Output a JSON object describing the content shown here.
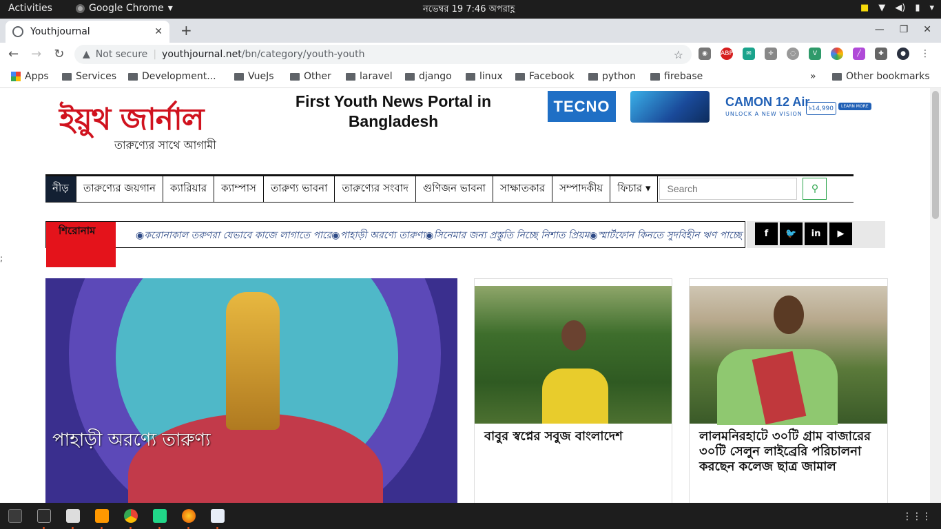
{
  "system": {
    "activities": "Activities",
    "app_name": "Google Chrome",
    "clock": "নভেম্বর 19   7:46 অপরাহ্ণ"
  },
  "browser": {
    "tab_title": "Youthjournal",
    "security": "Not secure",
    "url_host": "youthjournal.net",
    "url_path": "/bn/category/youth-youth",
    "bookmarks": [
      {
        "label": "Apps"
      },
      {
        "label": "Services"
      },
      {
        "label": "Development..."
      },
      {
        "label": "VueJs"
      },
      {
        "label": "Other"
      },
      {
        "label": "laravel"
      },
      {
        "label": "django"
      },
      {
        "label": "linux"
      },
      {
        "label": "Facebook"
      },
      {
        "label": "python"
      },
      {
        "label": "firebase"
      }
    ],
    "more_bookmarks": "»",
    "other_bookmarks": "Other bookmarks"
  },
  "site": {
    "logo_main": "ইয়ুথ জার্নাল",
    "logo_sub": "তারুণ্যের সাথে আগামী",
    "tagline": "First Youth News Portal in Bangladesh",
    "ad": {
      "brand": "TECNO",
      "model": "CAMON 12 Air",
      "vision": "UNLOCK A NEW VISION",
      "price": "৳14,990",
      "cta": "LEARN MORE"
    },
    "menu": [
      "নীড়",
      "তারুণ্যের জয়গান",
      "ক্যারিয়ার",
      "ক্যাম্পাস",
      "তারুণ্য ভাবনা",
      "তারুণ্যের সংবাদ",
      "গুণিজন ভাবনা",
      "সাক্ষাতকার",
      "সম্পাদকীয়",
      "ফিচার ▾"
    ],
    "search_placeholder": "Search",
    "ticker_head": "শিরোনাম",
    "ticker_text": "◉করোনাকাল তরুণরা যেভাবে কাজে লাগাতে পারে◉পাহাড়ী অরণ্যে তারুণ্য◉সিনেমার জন্য প্রস্তুতি নিচ্ছে নিশাত প্রিয়ম◉স্মার্টফোন কিনতে সুদবিহীন ঋণ পাচ্ছে",
    "social": [
      "f",
      "t",
      "in",
      "yt"
    ],
    "stray": ";",
    "featured_title": "পাহাড়ী অরণ্যে তারুণ্য",
    "cards": [
      {
        "title": "বাবুর স্বপ্নের সবুজ বাংলাদেশ"
      },
      {
        "title": "লালমনিরহাটে ৩০টি গ্রাম বাজারের ৩০টি সেলুন লাইব্রেরি পরিচালনা করছেন কলেজ ছাত্র জামাল"
      }
    ]
  },
  "colors": {
    "accent_red": "#e4131b",
    "menu_active": "#132033",
    "search_green": "#2aa44a",
    "ticker_text": "#2e4a86"
  }
}
